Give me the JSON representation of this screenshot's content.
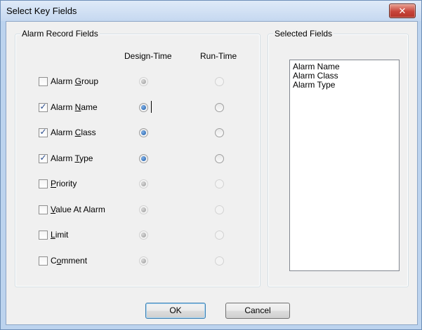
{
  "window": {
    "title": "Select Key Fields",
    "close_glyph": "✕",
    "close_icon": "close-icon"
  },
  "alarm_fields": {
    "legend": "Alarm Record Fields",
    "design_time_header": "Design-Time",
    "run_time_header": "Run-Time",
    "rows": [
      {
        "label": "Alarm Group",
        "mnemonic": "G",
        "checked": false,
        "design_selected": false
      },
      {
        "label": "Alarm Name",
        "mnemonic": "N",
        "checked": true,
        "design_selected": true
      },
      {
        "label": "Alarm Class",
        "mnemonic": "C",
        "checked": true,
        "design_selected": true
      },
      {
        "label": "Alarm Type",
        "mnemonic": "T",
        "checked": true,
        "design_selected": true
      },
      {
        "label": "Priority",
        "mnemonic": "P",
        "checked": false,
        "design_selected": false
      },
      {
        "label": "Value At Alarm",
        "mnemonic": "V",
        "checked": false,
        "design_selected": false
      },
      {
        "label": "Limit",
        "mnemonic": "L",
        "checked": false,
        "design_selected": false
      },
      {
        "label": "Comment",
        "mnemonic": "o",
        "checked": false,
        "design_selected": false
      }
    ]
  },
  "selected_fields": {
    "legend": "Selected Fields",
    "items": [
      "Alarm Name",
      "Alarm Class",
      "Alarm Type"
    ]
  },
  "buttons": {
    "ok": "OK",
    "cancel": "Cancel"
  },
  "colors": {
    "title_bg": "#c5d8f0",
    "close_red": "#c7443a",
    "radio_blue": "#1f5ca8"
  }
}
